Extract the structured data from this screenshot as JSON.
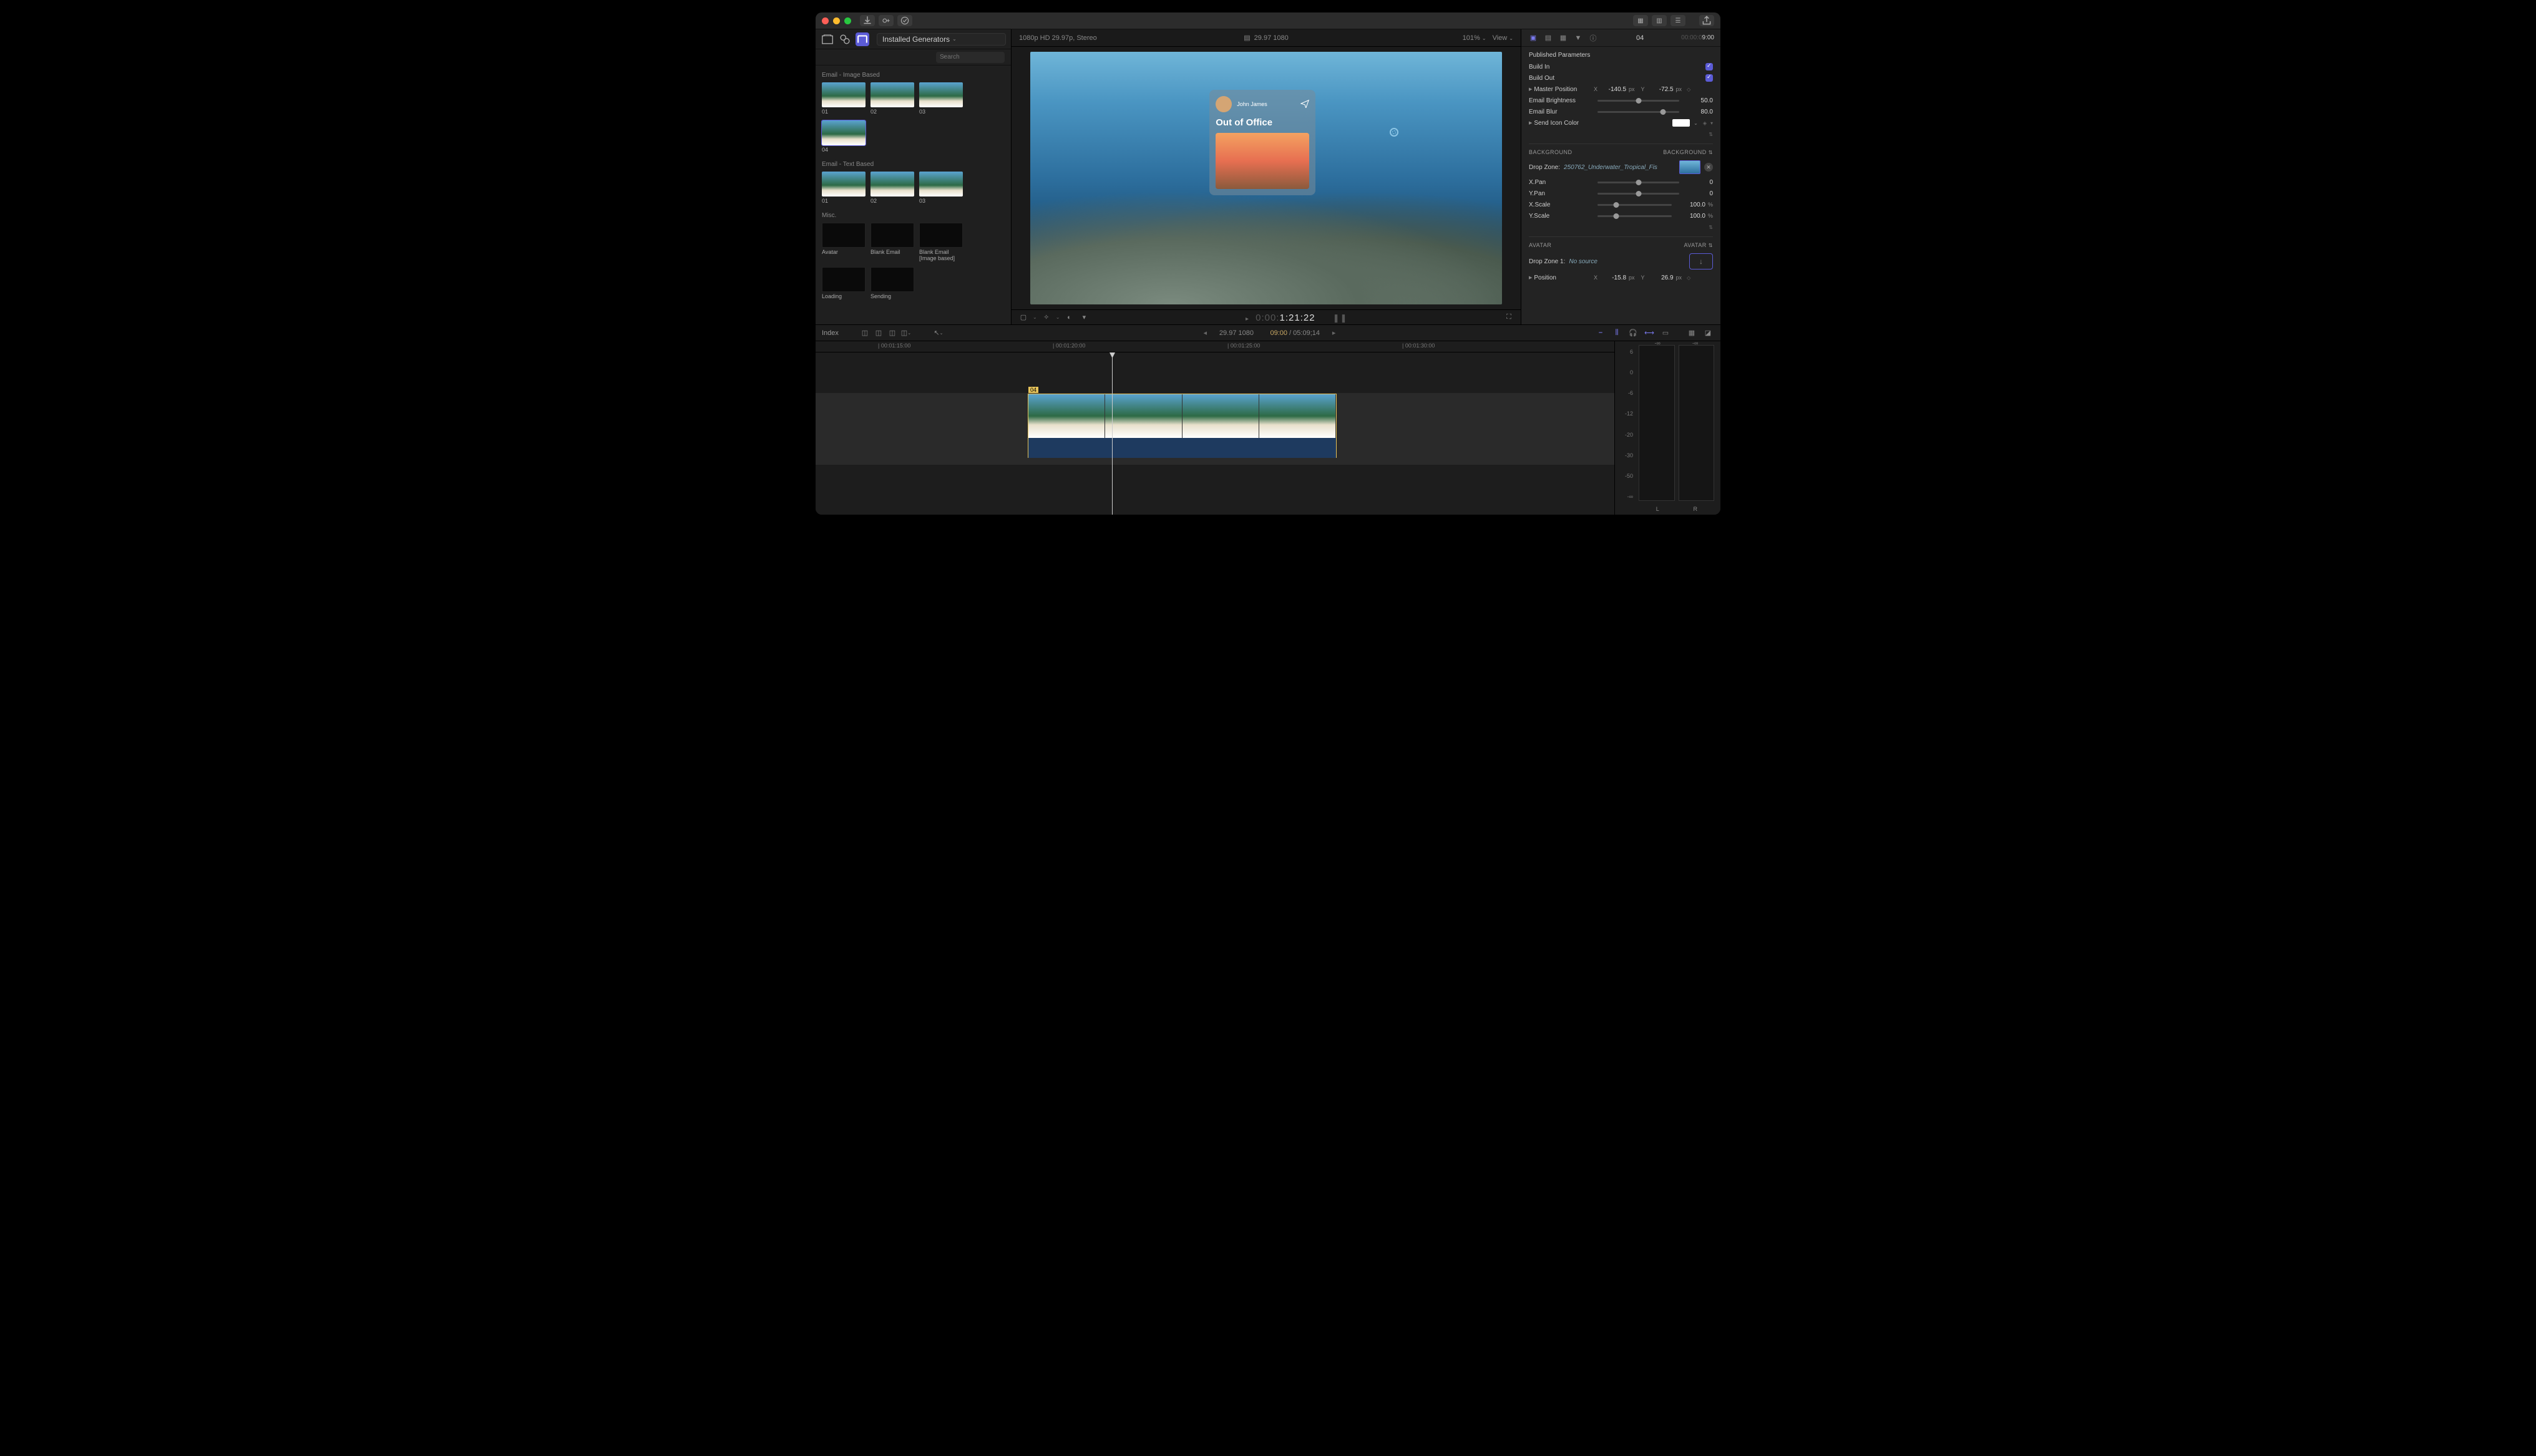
{
  "titlebar": {
    "download_icon": "download-icon",
    "key_icon": "key-icon",
    "check_icon": "check-circle-icon",
    "right_icons": [
      "grid-icon",
      "grid-icon",
      "sliders-icon"
    ],
    "share_icon": "share-icon"
  },
  "browser": {
    "tabs": [
      "library-icon",
      "photos-icon",
      "titles-icon"
    ],
    "library_label": "Installed Generators",
    "search_placeholder": "Search",
    "search_icon": "search-icon",
    "categories": [
      {
        "title": "Email - Image Based",
        "items": [
          "01",
          "02",
          "03",
          "04"
        ]
      },
      {
        "title": "Email - Text Based",
        "items": [
          "01",
          "02",
          "03"
        ]
      },
      {
        "title": "Misc.",
        "items": [
          "Avatar",
          "Blank Email",
          "Blank Email [Image based]",
          "Loading",
          "Sending"
        ]
      }
    ]
  },
  "viewer": {
    "format": "1080p HD 29.97p, Stereo",
    "rate": "29.97 1080",
    "zoom": "101%",
    "view_label": "View",
    "play_icon": "play-icon",
    "film_icon": "film-icon",
    "card": {
      "name": "John James",
      "title": "Out of Office"
    },
    "timecode_dim": "0:00:",
    "timecode": "1:21:22",
    "fullscreen_icon": "fullscreen-icon"
  },
  "inspector": {
    "tabs": [
      "generator-icon",
      "text-icon",
      "video-icon",
      "color-icon",
      "info-icon"
    ],
    "clip_name": "04",
    "tc_dim": "00:00:0",
    "tc": "9:00",
    "section": "Published Parameters",
    "params": {
      "build_in": "Build In",
      "build_out": "Build Out",
      "master_position": "Master Position",
      "master_x": "-140.5",
      "master_y": "-72.5",
      "email_brightness": "Email Brightness",
      "brightness_val": "50.0",
      "email_blur": "Email Blur",
      "blur_val": "80.0",
      "send_icon_color": "Send Icon Color"
    },
    "background": {
      "title": "BACKGROUND",
      "right": "BACKGROUND",
      "dz_label": "Drop Zone:",
      "dz_name": "250762_Underwater_Tropical_Fis",
      "xpan": "X.Pan",
      "xpan_val": "0",
      "ypan": "Y.Pan",
      "ypan_val": "0",
      "xscale": "X.Scale",
      "xscale_val": "100.0",
      "yscale": "Y.Scale",
      "yscale_val": "100.0",
      "pct": "%"
    },
    "avatar": {
      "title": "AVATAR",
      "right": "AVATAR",
      "dz_label": "Drop Zone 1:",
      "dz_name": "No source",
      "position": "Position",
      "px": "-15.8",
      "py": "26.9"
    },
    "units": {
      "px": "px",
      "x": "X",
      "y": "Y"
    }
  },
  "timeline": {
    "index_label": "Index",
    "center_rate": "29.97 1080",
    "center_pos": "09:00",
    "center_dur": "05:09;14",
    "ruler": [
      "00:01:15:00",
      "00:01:20:00",
      "00:01:25:00",
      "00:01:30:00"
    ],
    "clip_label": "04",
    "meters": {
      "scale": [
        "6",
        "0",
        "-6",
        "-12",
        "-20",
        "-30",
        "-50",
        "-∞"
      ],
      "inf": "-∞",
      "L": "L",
      "R": "R"
    }
  }
}
